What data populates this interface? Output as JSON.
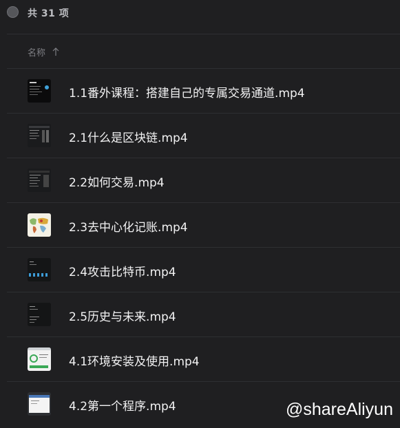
{
  "toolbar": {
    "count_label": "共 31 项"
  },
  "header": {
    "name_col": "名称"
  },
  "files": [
    {
      "name": "1.1番外课程：搭建自己的专属交易通道.mp4",
      "thumb": "dark-code"
    },
    {
      "name": "2.1什么是区块链.mp4",
      "thumb": "ui-panels"
    },
    {
      "name": "2.2如何交易.mp4",
      "thumb": "ui-panels-2"
    },
    {
      "name": "2.3去中心化记账.mp4",
      "thumb": "world-map"
    },
    {
      "name": "2.4攻击比特币.mp4",
      "thumb": "terminal-bars"
    },
    {
      "name": "2.5历史与未来.mp4",
      "thumb": "terminal"
    },
    {
      "name": "4.1环境安装及使用.mp4",
      "thumb": "install-window"
    },
    {
      "name": "4.2第一个程序.mp4",
      "thumb": "editor-window"
    }
  ],
  "watermark": "@shareAliyun",
  "colors": {
    "background": "#1f1f21",
    "divider": "#2e2f32",
    "text": "#f2f2f3",
    "muted": "#7d7e83"
  }
}
